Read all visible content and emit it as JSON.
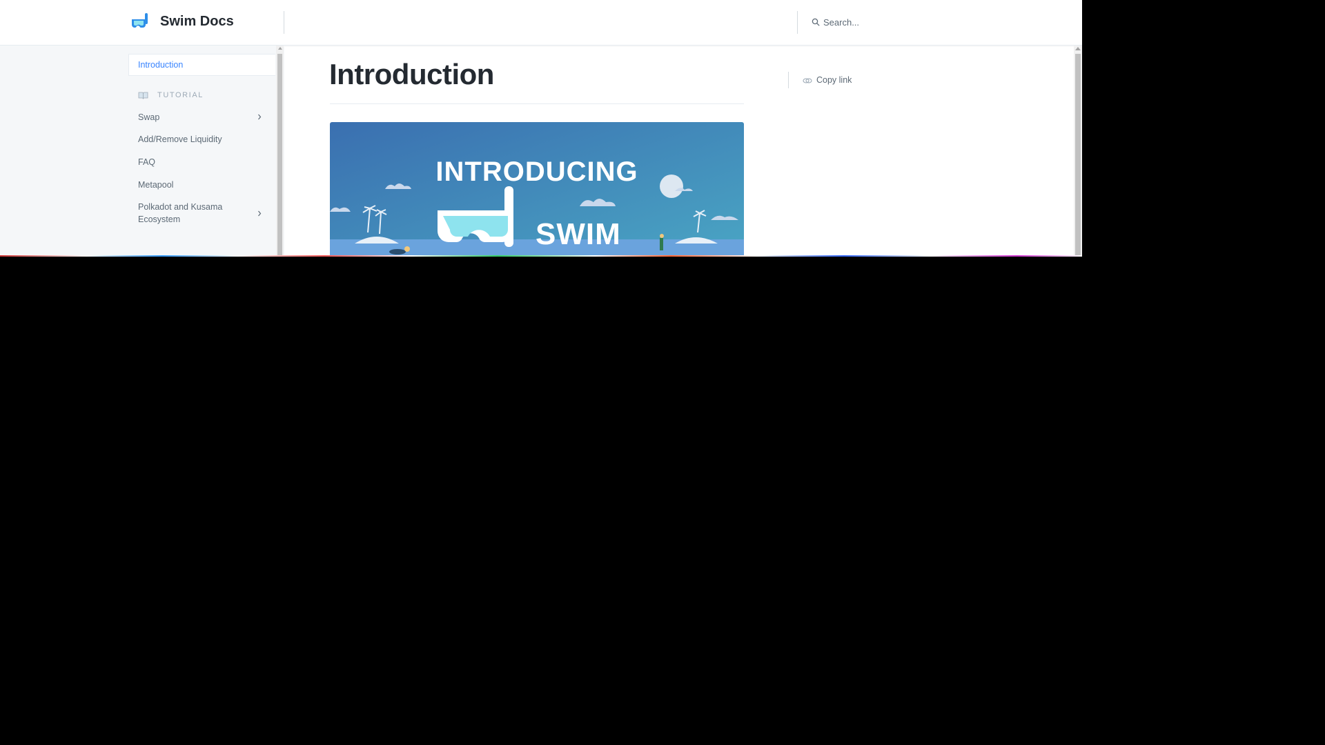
{
  "header": {
    "logo_text": "Swim Docs",
    "search_placeholder": "Search..."
  },
  "sidebar": {
    "active_item": "Introduction",
    "section_label": "TUTORIAL",
    "items": [
      {
        "label": "Swap",
        "has_children": true
      },
      {
        "label": "Add/Remove Liquidity",
        "has_children": false
      },
      {
        "label": "FAQ",
        "has_children": false
      },
      {
        "label": "Metapool",
        "has_children": false
      },
      {
        "label": "Polkadot and Kusama Ecosystem",
        "has_children": true
      }
    ]
  },
  "main": {
    "title": "Introduction",
    "copy_link_label": "Copy link",
    "hero_image": {
      "line1": "INTRODUCING",
      "line2": "SWIM"
    }
  },
  "colors": {
    "accent": "#3884ff",
    "hero_sky_top": "#3a7bbd",
    "hero_sky_bottom": "#4aa6c4"
  }
}
